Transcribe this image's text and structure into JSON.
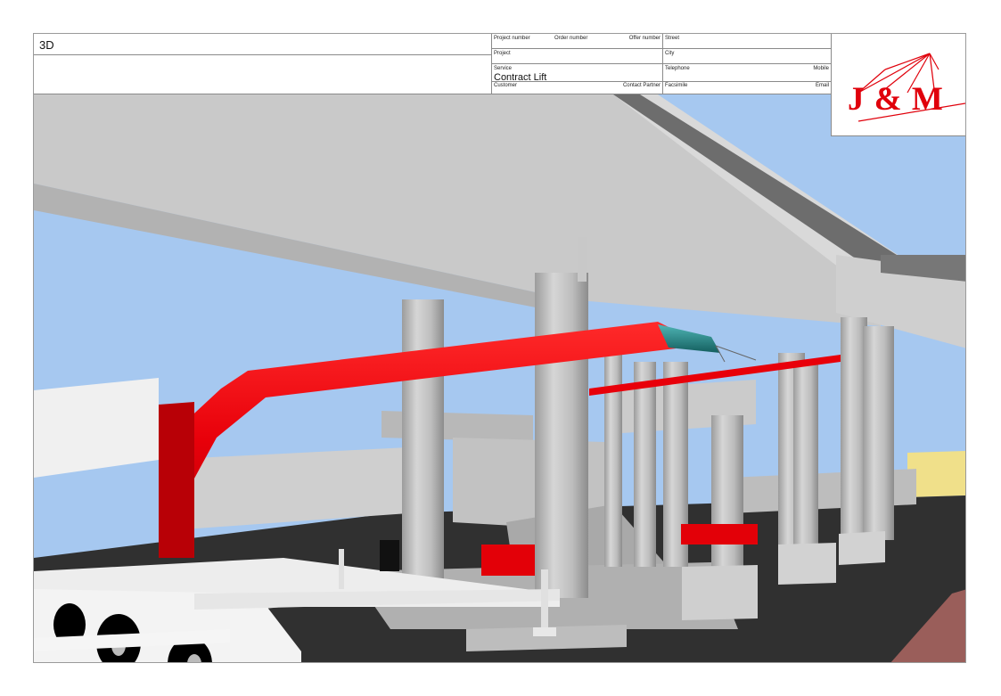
{
  "title_block": {
    "view_title": "3D",
    "project_number_label": "Project number",
    "order_number_label": "Order number",
    "offer_number_label": "Offer number",
    "street_label": "Street",
    "project_label": "Project",
    "city_label": "City",
    "service_label": "Service",
    "service_value": "Contract Lift",
    "telephone_label": "Telephone",
    "mobile_label": "Mobile",
    "customer_label": "Customer",
    "contact_partner_label": "Contact Partner",
    "facsimile_label": "Facsimile",
    "email_label": "Email"
  },
  "logo": {
    "text": "J & M",
    "color": "#e0000b"
  },
  "scene_colors": {
    "sky": "#a6c8f0",
    "concrete": "#c8c8c8",
    "asphalt": "#303030",
    "red_beam": "#e8000a",
    "teal_end": "#1f8f8f",
    "sand": "#f0e08a"
  },
  "icons": {
    "logo_mark": "crane-lines-icon"
  }
}
